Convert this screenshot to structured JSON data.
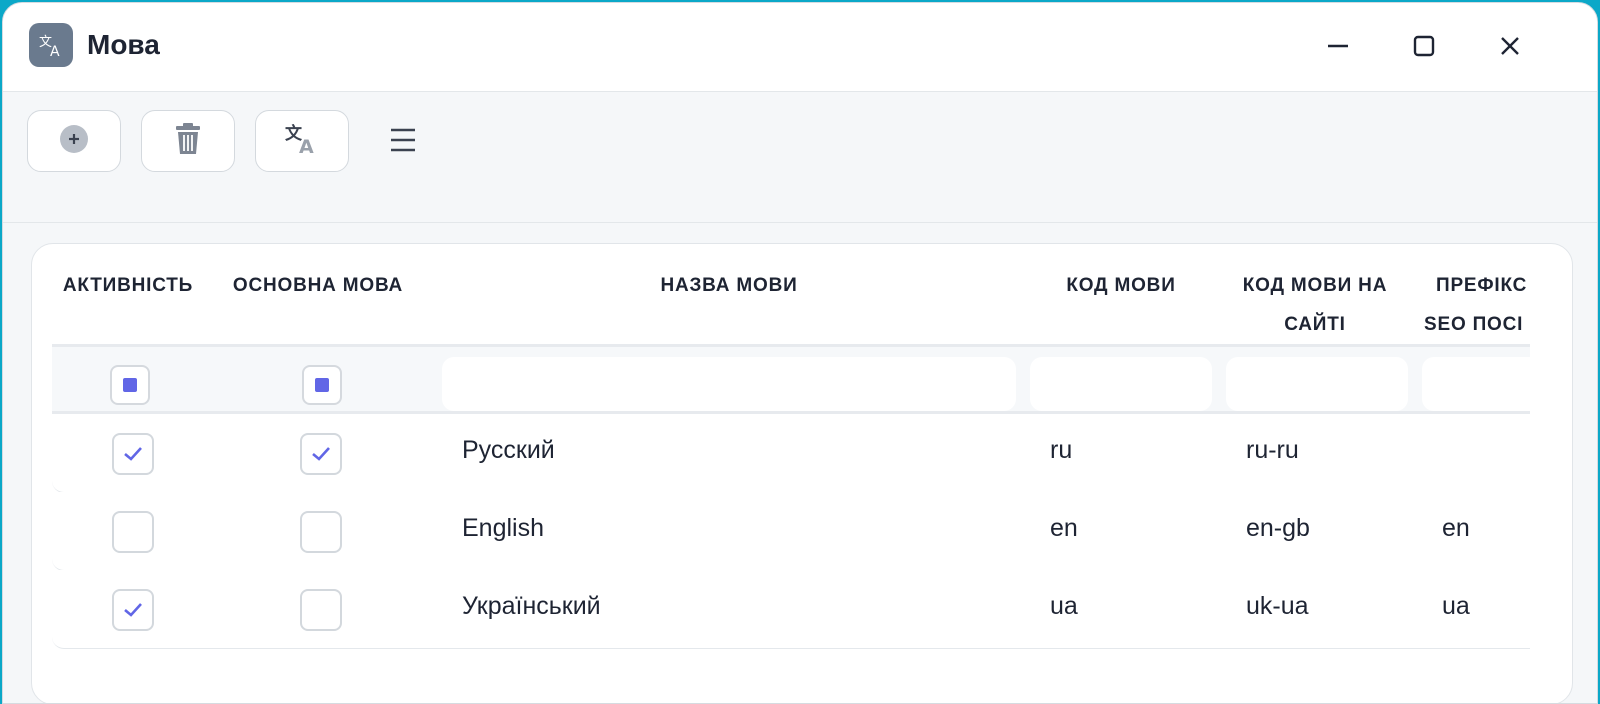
{
  "window": {
    "title": "Мова",
    "app_icon": "translate-icon",
    "controls": [
      "minimize-icon",
      "maximize-icon",
      "close-icon"
    ]
  },
  "toolbar": {
    "buttons": [
      "plus-circle-icon",
      "trash-icon",
      "translate-icon"
    ],
    "menu": "hamburger-menu-icon"
  },
  "table": {
    "headers": {
      "active": "АКТИВНІСТЬ",
      "main": "ОСНОВНА МОВА",
      "name": "НАЗВА МОВИ",
      "code": "КОД МОВИ",
      "site_code_1": "КОД МОВИ НА",
      "site_code_2": "САЙТІ",
      "prefix_1": "ПРЕФІКС",
      "prefix_2": "SEO ПОСІ"
    },
    "filter": {
      "active": "indeterminate",
      "main": "indeterminate"
    },
    "rows": [
      {
        "active": true,
        "main": true,
        "name": "Русский",
        "code": "ru",
        "site_code": "ru-ru",
        "prefix": ""
      },
      {
        "active": false,
        "main": false,
        "name": "English",
        "code": "en",
        "site_code": "en-gb",
        "prefix": "en"
      },
      {
        "active": true,
        "main": false,
        "name": "Український",
        "code": "ua",
        "site_code": "uk-ua",
        "prefix": "ua"
      }
    ]
  },
  "colors": {
    "accent": "#6166e6",
    "app_icon_bg": "#6a7a8e",
    "text": "#1e2433",
    "desktop": "#0ba8c8"
  }
}
